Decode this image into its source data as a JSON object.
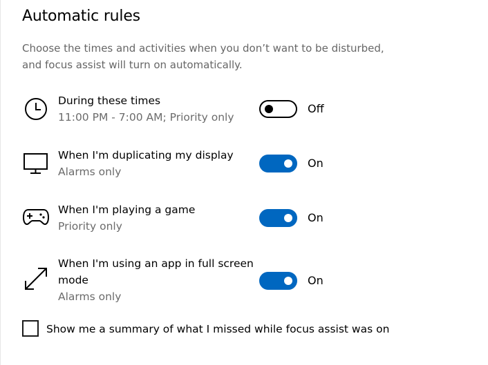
{
  "section": {
    "title": "Automatic rules",
    "description_line1": "Choose the times and activities when you don’t want to be disturbed,",
    "description_line2": "and focus assist will turn on automatically."
  },
  "rules": [
    {
      "icon": "clock-icon",
      "title": "During these times",
      "subtitle": "11:00 PM - 7:00 AM; Priority only",
      "toggle_on": false,
      "state_label": "Off"
    },
    {
      "icon": "monitor-icon",
      "title": "When I'm duplicating my display",
      "subtitle": "Alarms only",
      "toggle_on": true,
      "state_label": "On"
    },
    {
      "icon": "gamepad-icon",
      "title": "When I'm playing a game",
      "subtitle": "Priority only",
      "toggle_on": true,
      "state_label": "On"
    },
    {
      "icon": "fullscreen-arrow-icon",
      "title": "When I'm using an app in full screen mode",
      "subtitle": "Alarms only",
      "toggle_on": true,
      "state_label": "On"
    }
  ],
  "summary_checkbox": {
    "label": "Show me a summary of what I missed while focus assist was on",
    "checked": false
  },
  "colors": {
    "accent": "#0067c0",
    "secondary_text": "#6b6b6b"
  }
}
